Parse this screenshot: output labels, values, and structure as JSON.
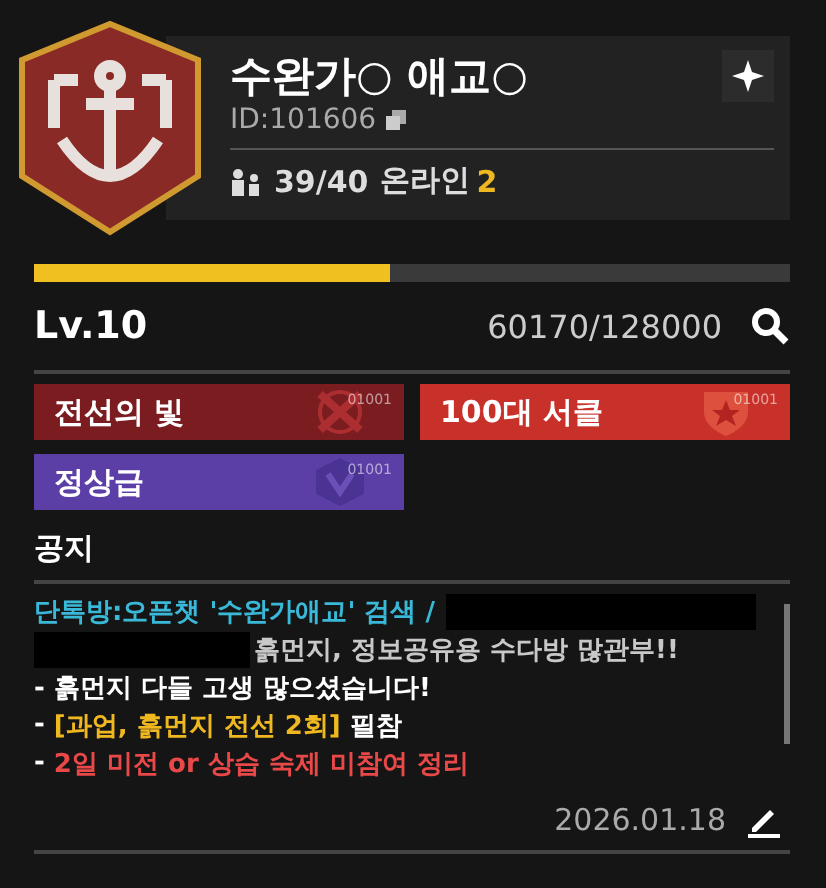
{
  "guild": {
    "name": "수완가○ 애교○",
    "id": "ID:101606",
    "members": "39/40",
    "online_label": "온라인",
    "online_count": "2"
  },
  "progress": {
    "level": 0.47
  },
  "level": {
    "label": "Lv.10",
    "exp": "60170/128000"
  },
  "tags": [
    {
      "label": "전선의 빛",
      "code": "01001",
      "kind": "swords",
      "color": "#7a1c20"
    },
    {
      "label": "100대 서클",
      "code": "01001",
      "kind": "shield",
      "color": "#c8302a"
    },
    {
      "label": "정상급",
      "code": "01001",
      "kind": "badge",
      "color": "#5b3fa6"
    }
  ],
  "notice": {
    "title": "공지",
    "date": "2026.01.18",
    "lines": [
      {
        "segments": [
          {
            "kind": "text",
            "text": "단톡방:오픈챗 '수완가애교' 검색 /",
            "color": "#39b8d8"
          },
          {
            "kind": "redaction"
          }
        ]
      },
      {
        "segments": [
          {
            "kind": "redaction"
          },
          {
            "kind": "text",
            "text": "흙먼지, 정보공유용 수다방 많관부!!",
            "color": "#c8c8c8"
          }
        ]
      },
      {
        "segments": [
          {
            "kind": "text",
            "text": "- 흙먼지 다들 고생 많으셨습니다!",
            "color": "#ffffff"
          }
        ]
      },
      {
        "segments": [
          {
            "kind": "text",
            "text": "- ",
            "color": "#ffffff"
          },
          {
            "kind": "text",
            "text": "[과업, 흙먼지 전선 2회]",
            "color": "#f0b820"
          },
          {
            "kind": "text",
            "text": " 필참",
            "color": "#ffffff"
          }
        ]
      },
      {
        "segments": [
          {
            "kind": "text",
            "text": "- ",
            "color": "#ffffff"
          },
          {
            "kind": "text",
            "text": "2일 미전 or 상습 숙제 미참여 정리",
            "color": "#e84848"
          }
        ]
      }
    ]
  }
}
